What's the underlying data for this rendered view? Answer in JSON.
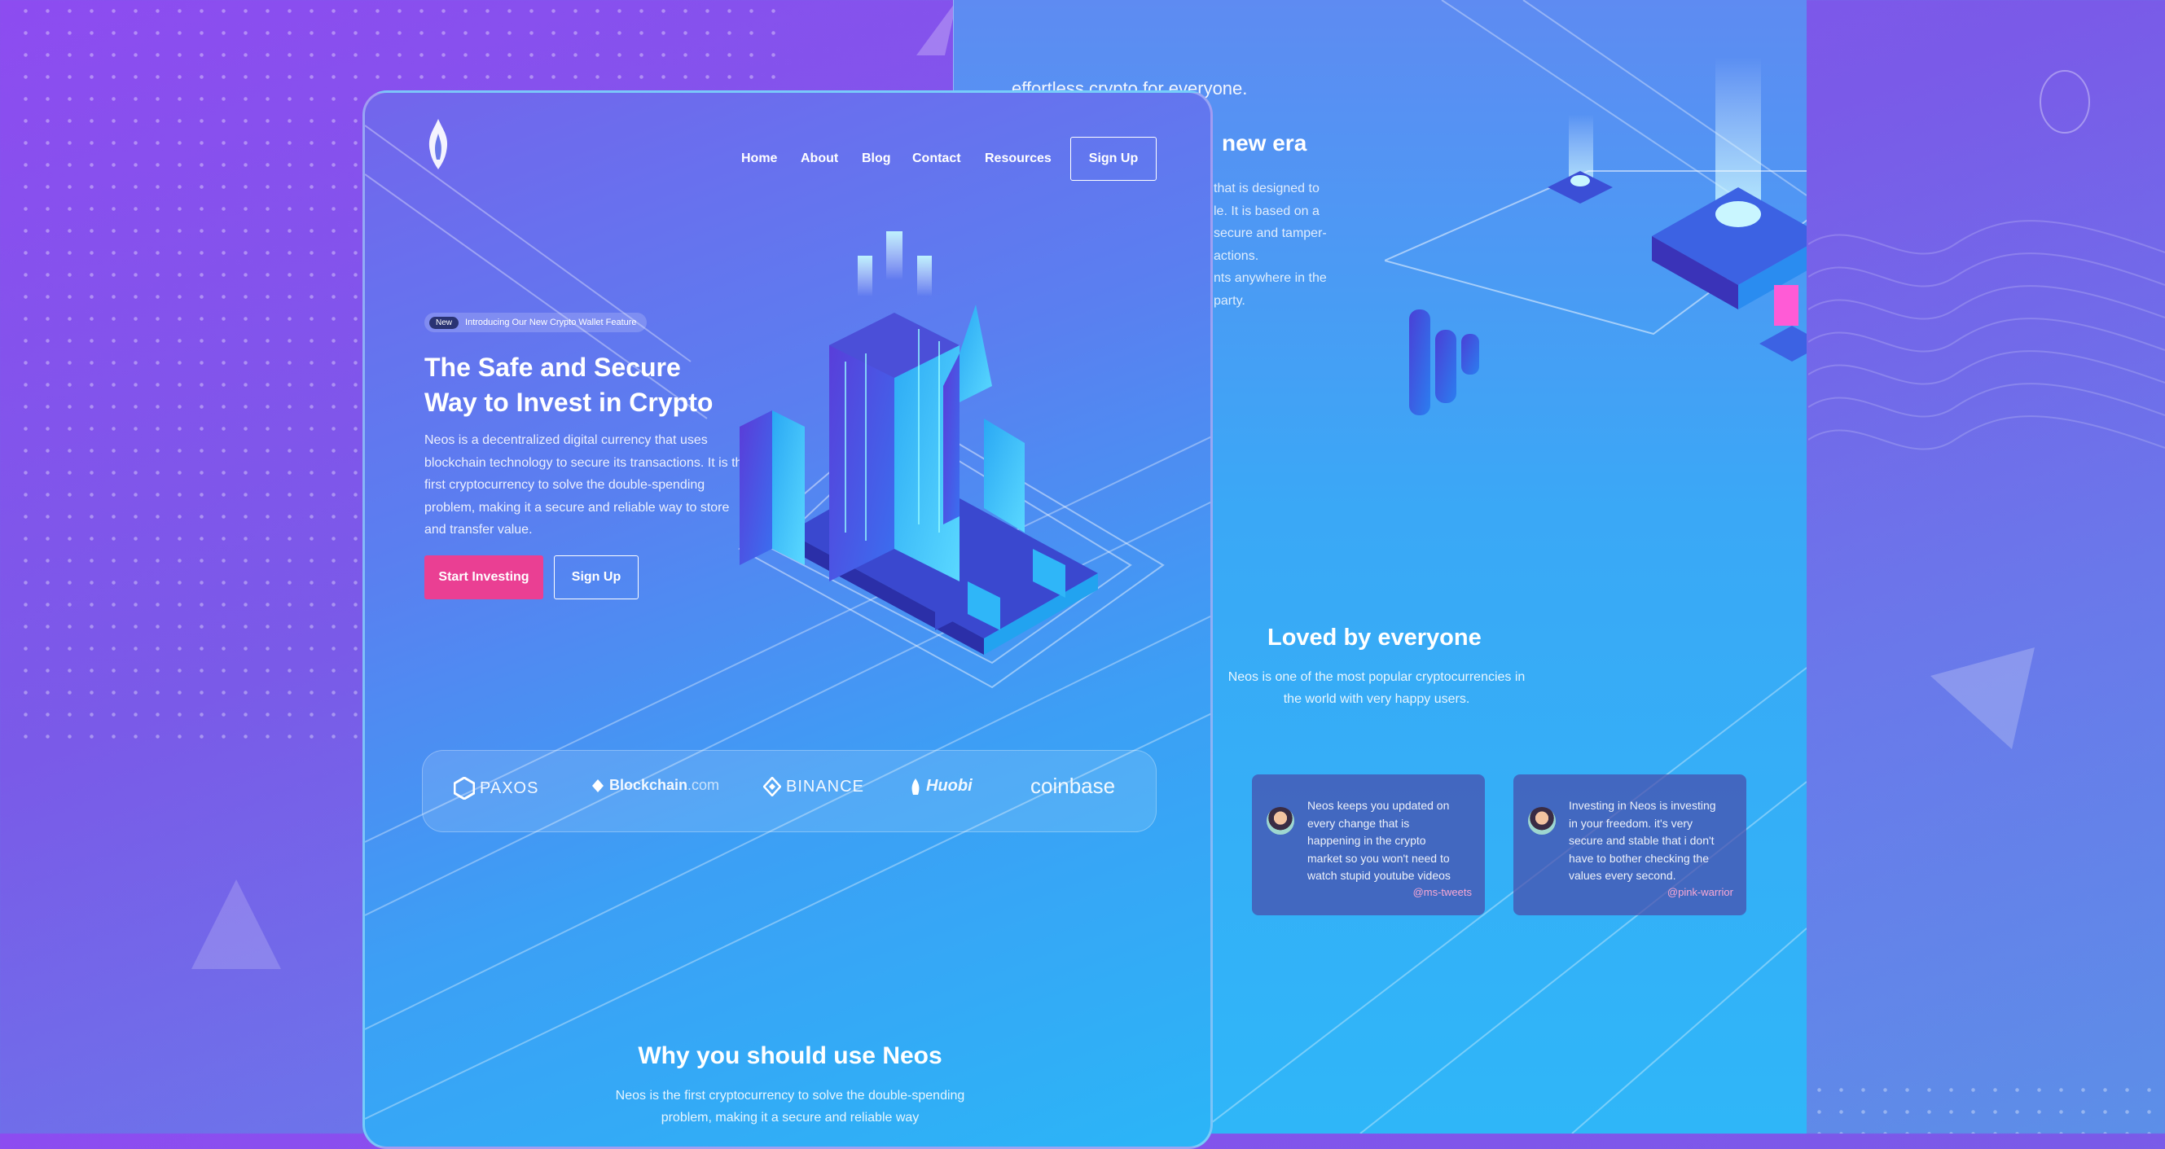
{
  "colors": {
    "background_start": "#8d4cf0",
    "background_end": "#5c8fe8",
    "accent_pink": "#ea3f93",
    "cyan": "#2bb5f7",
    "handle_pink": "#f9a8d4"
  },
  "back_page": {
    "fragment_text": "effortless crypto for everyone.",
    "era_heading": "new era",
    "era_body_lines": [
      "that is designed to",
      "le. It is based on a",
      "secure and tamper-",
      "actions.",
      "nts anywhere in the",
      "party."
    ],
    "loved_title": "Loved by everyone",
    "loved_sub_line1": "Neos is one of the most popular cryptocurrencies in",
    "loved_sub_line2": "the world with very happy users.",
    "testimonials": [
      {
        "text": "Neos keeps you updated on every change that is happening in the crypto market so you won't need to watch stupid youtube videos",
        "handle": "@ms-tweets"
      },
      {
        "text": "Investing in Neos is investing in your freedom. it's very secure and stable that i don't have to bother checking the values every second.",
        "handle": "@pink-warrior"
      }
    ]
  },
  "front_page": {
    "logo_icon": "flame-icon",
    "nav": {
      "home": "Home",
      "about": "About",
      "blog": "Blog",
      "contact": "Contact",
      "resources": "Resources",
      "signup": "Sign Up"
    },
    "badge": {
      "tag": "New",
      "text": "Introducing Our New Crypto Wallet Feature"
    },
    "hero_title_line1": "The Safe and Secure",
    "hero_title_line2": "Way to Invest in Crypto",
    "hero_body": "Neos is a decentralized digital currency that uses blockchain technology to secure its transactions. It is the first cryptocurrency to solve the double-spending problem, making it a secure and reliable way to store and transfer value.",
    "cta_primary": "Start Investing",
    "cta_secondary": "Sign Up",
    "partners": {
      "paxos": "PAXOS",
      "blockchain": "Blockchain",
      "blockchain_suffix": ".com",
      "binance": "BINANCE",
      "huobi": "Huobi",
      "coinbase": "coinbase"
    },
    "why_title": "Why you should use Neos",
    "why_body": "Neos is the first cryptocurrency to solve the double-spending problem, making it a secure and reliable way"
  }
}
